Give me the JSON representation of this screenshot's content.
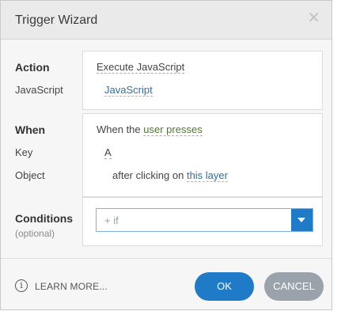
{
  "dialog": {
    "title": "Trigger Wizard",
    "close_glyph": "✕"
  },
  "action_section": {
    "label_action": "Action",
    "label_javascript": "JavaScript",
    "action_value": "Execute JavaScript",
    "javascript_value": "JavaScript"
  },
  "when_section": {
    "label_when": "When",
    "label_key": "Key",
    "label_object": "Object",
    "when_prefix": "When the",
    "when_value": "user presses",
    "key_value": "A",
    "object_prefix": "after clicking on",
    "object_value": "this layer"
  },
  "conditions_section": {
    "label": "Conditions",
    "sublabel": "(optional)",
    "select_value": "+ if"
  },
  "footer": {
    "info_glyph": "i",
    "learn_more": "LEARN MORE...",
    "ok_label": "OK",
    "cancel_label": "CANCEL"
  },
  "colors": {
    "accent": "#1f7bc8",
    "cancel": "#9aa3ab",
    "link": "#2f6fa8",
    "link_green": "#4e7a2a"
  }
}
